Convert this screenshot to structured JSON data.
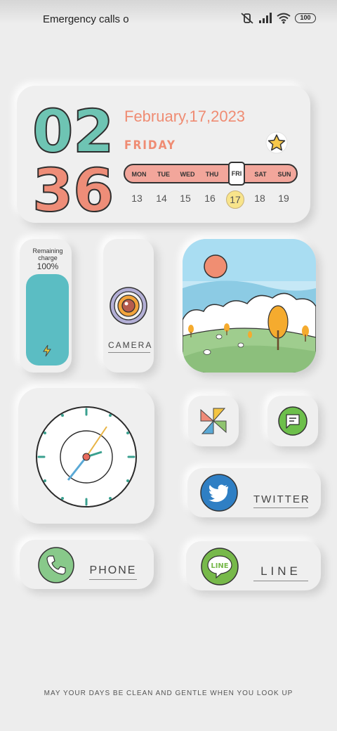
{
  "status_bar": {
    "carrier": "Emergency calls o",
    "battery": "100"
  },
  "date_widget": {
    "hour_tens": "0",
    "hour_ones": "2",
    "minute_tens": "3",
    "minute_ones": "6",
    "date": "February,17,2023",
    "weekday": "FRIDAY",
    "week_days": [
      "MON",
      "TUE",
      "WED",
      "THU",
      "FRI",
      "SAT",
      "SUN"
    ],
    "week_dates": [
      "13",
      "14",
      "15",
      "16",
      "17",
      "18",
      "19"
    ],
    "today_index": 4,
    "colors": {
      "hour": "#6ec4b3",
      "minute": "#ee8d78",
      "accent": "#ef8c73"
    }
  },
  "battery_widget": {
    "title_line1": "Remaining",
    "title_line2": "charge",
    "percent": "100%",
    "level": 1.0,
    "color": "#5bbdc3"
  },
  "camera_app": {
    "label": "CAMERA"
  },
  "twitter_app": {
    "label": "TWITTER"
  },
  "phone_app": {
    "label": "PHONE"
  },
  "line_app": {
    "label": "LINE",
    "icon_text": "LINE"
  },
  "footer": {
    "text": "MAY YOUR DAYS BE CLEAN AND GENTLE WHEN YOU LOOK UP"
  },
  "icons": [
    "mute-icon",
    "signal-icon",
    "wifi-icon",
    "battery-icon",
    "star-icon",
    "bolt-icon",
    "camera-lens-icon",
    "landscape-picture",
    "clock-face",
    "photos-pinwheel-icon",
    "message-icon",
    "twitter-bird-icon",
    "phone-handset-icon",
    "line-icon"
  ]
}
